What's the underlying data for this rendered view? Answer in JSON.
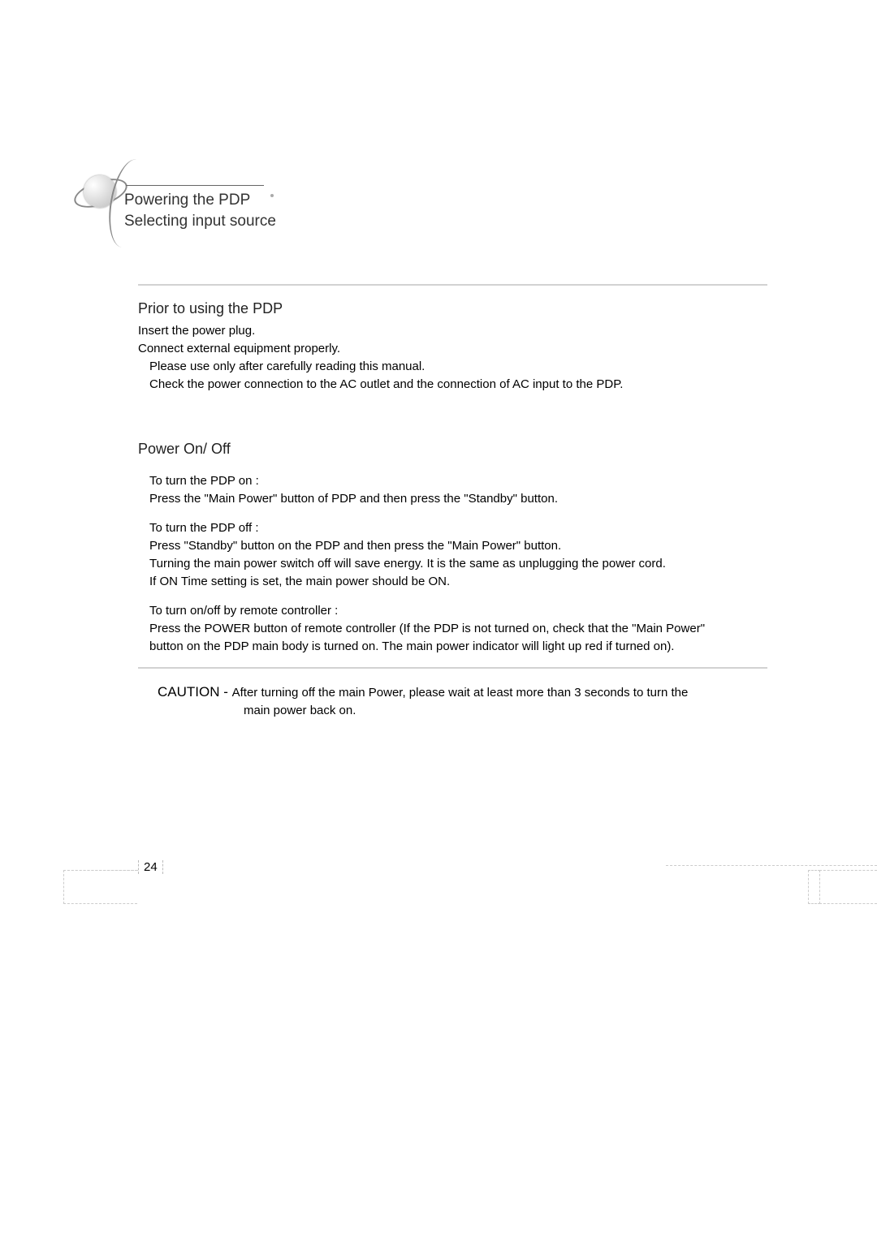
{
  "header": {
    "title_line1": "Powering the PDP",
    "title_line2": "Selecting input source"
  },
  "prior": {
    "heading": "Prior to using the PDP",
    "line1": "Insert the power plug.",
    "line2": "Connect external equipment properly.",
    "line3": "Please use only after carefully reading this manual.",
    "line4": "Check the power connection to the AC outlet and the connection of AC input to the PDP."
  },
  "power": {
    "heading": "Power On/ Off",
    "on_title": "To turn the PDP on :",
    "on_body": "Press the \"Main Power\" button of PDP and then press the \"Standby\" button.",
    "off_title": "To turn the PDP off :",
    "off_body1": "Press \"Standby\" button on the PDP and then press the \"Main Power\" button.",
    "off_body2": "Turning the main power switch off will save energy. It is the same as unplugging the power cord.",
    "off_body3": "If ON Time setting is set, the main power should be ON.",
    "remote_title": "To turn on/off by remote controller :",
    "remote_body1": "Press the POWER button of remote controller (If the PDP is not turned on, check that the \"Main Power\"",
    "remote_body2": "button on the PDP main body is turned on. The main power indicator will light up red if turned on)."
  },
  "caution": {
    "label": "CAUTION - ",
    "text1": "After turning off the main Power, please wait at least more than 3 seconds to turn the",
    "text2": "main power back on."
  },
  "page_number": "24"
}
